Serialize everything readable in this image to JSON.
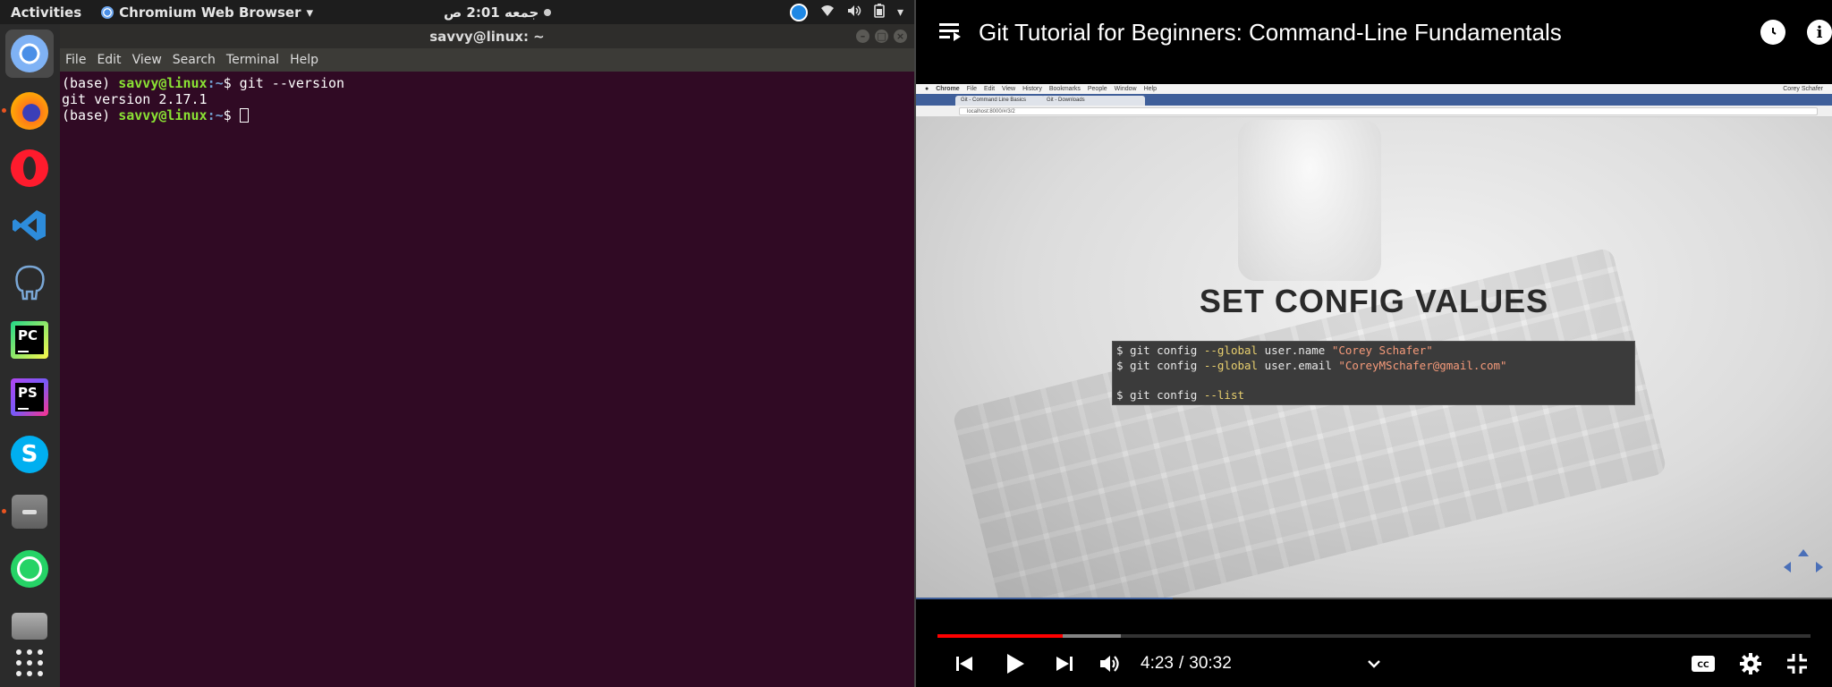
{
  "topbar": {
    "activities": "Activities",
    "app_name": "Chromium Web Browser",
    "app_menu_arrow": "▾",
    "clock": "جمعه  2:01 ص",
    "tray_menu_arrow": "▾"
  },
  "dock": {
    "items": [
      {
        "name": "chromium",
        "active": true
      },
      {
        "name": "firefox"
      },
      {
        "name": "opera"
      },
      {
        "name": "vscode"
      },
      {
        "name": "pgadmin"
      },
      {
        "name": "pycharm",
        "label": "PC"
      },
      {
        "name": "phpstorm",
        "label": "PS"
      },
      {
        "name": "skype",
        "label": "S"
      },
      {
        "name": "files"
      },
      {
        "name": "whatsapp"
      },
      {
        "name": "camera"
      },
      {
        "name": "show-applications"
      }
    ]
  },
  "terminal": {
    "title": "savvy@linux: ~",
    "menu": [
      "File",
      "Edit",
      "View",
      "Search",
      "Terminal",
      "Help"
    ],
    "lines": [
      {
        "prefix": "(base) ",
        "user": "savvy@linux",
        "path": ":~",
        "rest": "$ git --version"
      },
      {
        "output": "git version 2.17.1"
      },
      {
        "prefix": "(base) ",
        "user": "savvy@linux",
        "path": ":~",
        "rest": "$ "
      }
    ]
  },
  "player": {
    "title": "Git Tutorial for Beginners: Command-Line Fundamentals",
    "watch_later_icon": "clock-icon",
    "info_icon": "info-icon",
    "info_glyph": "i",
    "video": {
      "mac_menu": [
        "Chrome",
        "File",
        "Edit",
        "View",
        "History",
        "Bookmarks",
        "People",
        "Window",
        "Help"
      ],
      "mac_user": "Corey Schafer",
      "tabs": [
        "Git - Command Line Basics",
        "Git - Downloads"
      ],
      "url": "localhost:8000/#/3/2",
      "slide_title": "SET CONFIG VALUES",
      "code": [
        {
          "cmd": "$ git config ",
          "flag": "--global",
          "mid": " user.name ",
          "str": "\"Corey Schafer\""
        },
        {
          "cmd": "$ git config ",
          "flag": "--global",
          "mid": " user.email ",
          "str": "\"CoreyMSchafer@gmail.com\""
        },
        {
          "cmd": "",
          "flag": "",
          "mid": "",
          "str": ""
        },
        {
          "cmd": "$ git config ",
          "flag": "--list",
          "mid": "",
          "str": ""
        }
      ],
      "slide_progress": 0.28
    },
    "progress": {
      "played": 0.143,
      "buffered": 0.21
    },
    "time_current": "4:23",
    "time_separator": "/",
    "time_total": "30:32",
    "colors": {
      "played": "#ff0000",
      "accent": "#3f5f9a"
    }
  }
}
